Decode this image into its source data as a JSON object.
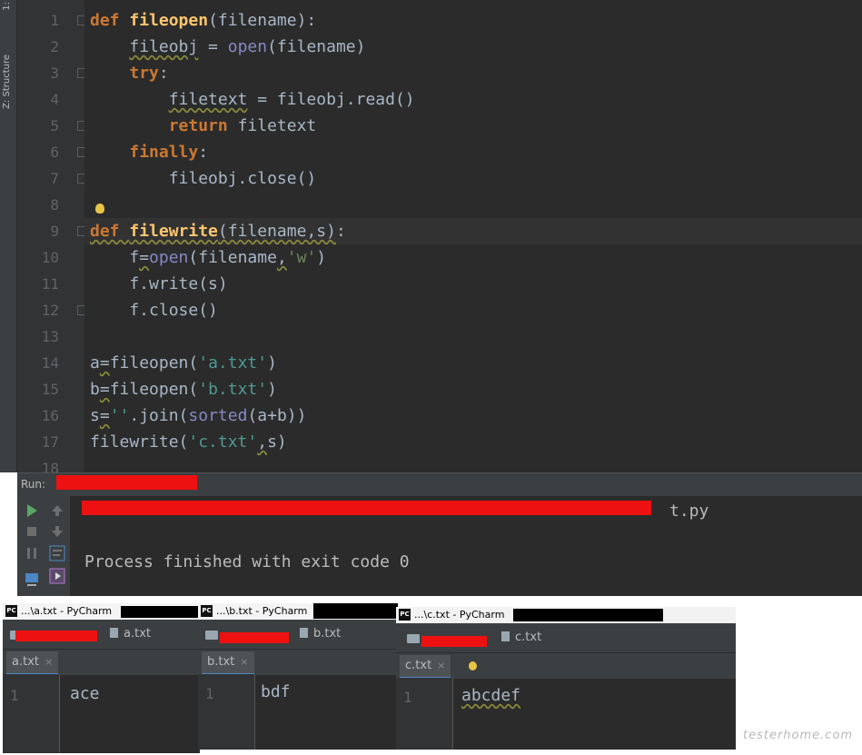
{
  "side_strip": {
    "tabs": [
      "Z: Structure",
      "1:"
    ]
  },
  "editor": {
    "lines": [
      {
        "n": "1"
      },
      {
        "n": "2"
      },
      {
        "n": "3"
      },
      {
        "n": "4"
      },
      {
        "n": "5"
      },
      {
        "n": "6"
      },
      {
        "n": "7"
      },
      {
        "n": "8"
      },
      {
        "n": "9"
      },
      {
        "n": "10"
      },
      {
        "n": "11"
      },
      {
        "n": "12"
      },
      {
        "n": "13"
      },
      {
        "n": "14"
      },
      {
        "n": "15"
      },
      {
        "n": "16"
      },
      {
        "n": "17"
      },
      {
        "n": "18"
      }
    ]
  },
  "run": {
    "label": "Run:",
    "out1_tail": "t.py",
    "out2": "Process finished with exit code 0"
  },
  "windows": [
    {
      "title": "...\\a.txt - PyCharm",
      "crumb": "a.txt",
      "tab": "a.txt",
      "line": "1",
      "content": "ace"
    },
    {
      "title": "...\\b.txt - PyCharm",
      "crumb": "b.txt",
      "tab": "b.txt",
      "line": "1",
      "content": "bdf"
    },
    {
      "title": "...\\c.txt - PyCharm",
      "crumb": "c.txt",
      "tab": "c.txt",
      "line": "1",
      "content": "abcdef"
    }
  ],
  "icons": {
    "pc": "PC",
    "close": "×"
  },
  "watermark": "testerhome.com",
  "colors": {
    "keyword": "#cc7832",
    "function": "#ffc66d",
    "builtin": "#8888c6",
    "string": "#6a8759",
    "text": "#a9b7c6",
    "bg": "#2b2b2b"
  }
}
